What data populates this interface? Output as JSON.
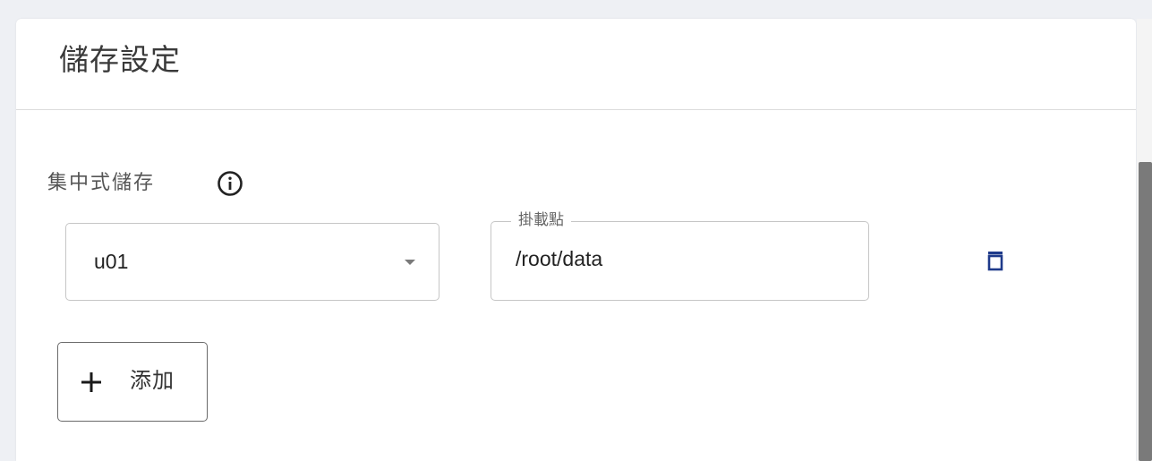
{
  "card": {
    "title": "儲存設定"
  },
  "storage": {
    "section_label": "集中式儲存",
    "info_icon": "info-circle-icon",
    "select": {
      "value": "u01",
      "icon": "caret-down-icon"
    },
    "mount_field": {
      "label": "掛載點",
      "value": "/root/data"
    },
    "delete_icon": "trash-icon",
    "accent_color": "#1e3a8a"
  },
  "actions": {
    "add_label": "添加",
    "add_icon": "plus-icon"
  }
}
